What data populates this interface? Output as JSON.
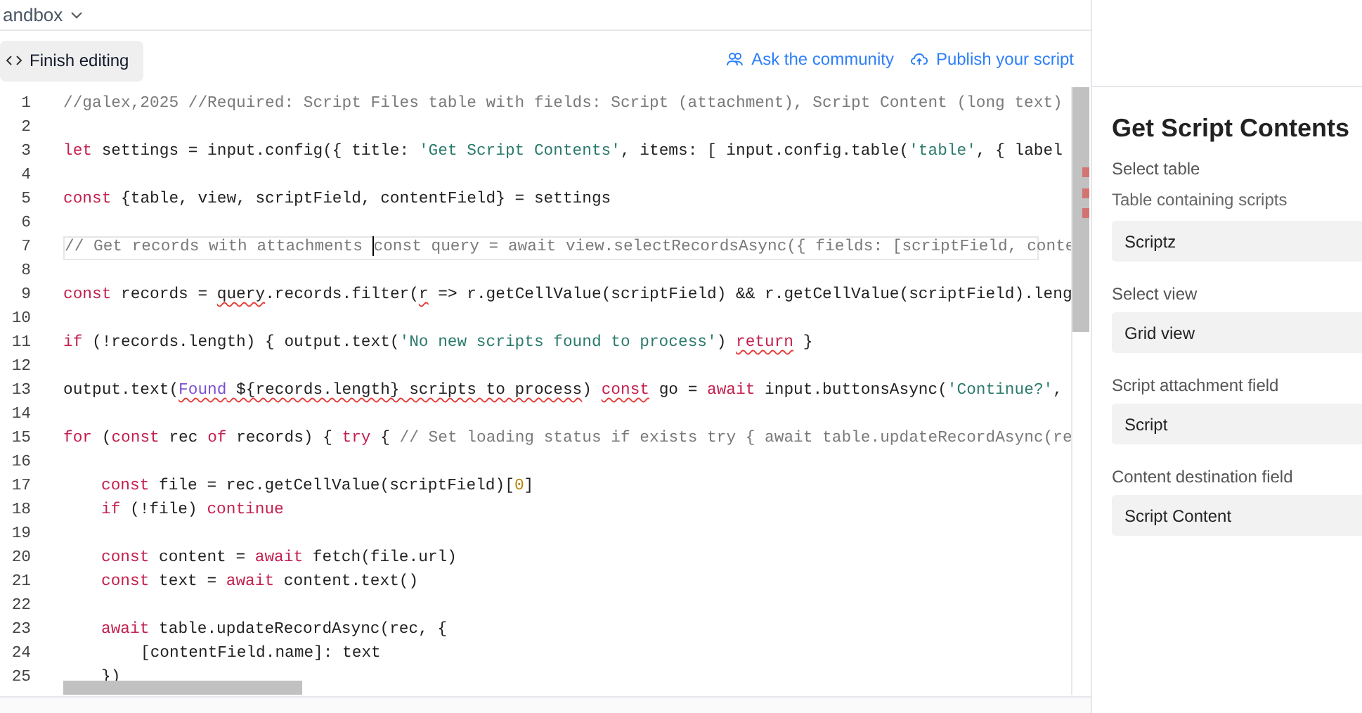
{
  "header": {
    "base_name": "andbox"
  },
  "toolbar": {
    "finish_button": "Finish editing",
    "links": [
      {
        "kind": "community",
        "label": "Ask the community"
      },
      {
        "kind": "publish",
        "label": "Publish your script"
      }
    ]
  },
  "editor": {
    "lines": [
      {
        "number": "1",
        "tokens": [
          {
            "t": "//galex,2025 //Required: Script Files table with fields: Script (attachment), Script Content (long text)",
            "kind": "comment"
          }
        ]
      },
      {
        "number": "2"
      },
      {
        "number": "3",
        "tokens": [
          {
            "t": "let",
            "kind": "keyword"
          },
          {
            "t": " settings = input.config({ title: ",
            "kind": "plain"
          },
          {
            "t": "'Get Script Contents'",
            "kind": "string"
          },
          {
            "t": ", items: [ input.config.table(",
            "kind": "plain"
          },
          {
            "t": "'table'",
            "kind": "string"
          },
          {
            "t": ", { label",
            "kind": "plain"
          }
        ]
      },
      {
        "number": "4"
      },
      {
        "number": "5",
        "tokens": [
          {
            "t": "const",
            "kind": "keyword"
          },
          {
            "t": " {table, view, scriptField, contentField} = settings",
            "kind": "plain"
          }
        ]
      },
      {
        "number": "6"
      },
      {
        "number": "7",
        "current": true,
        "tokens": [
          {
            "t": "// Get records with attachments ",
            "kind": "comment"
          },
          {
            "t": "const query = await view.selectRecordsAsync({ fields: [scriptField, conte",
            "kind": "comment",
            "cursor": true
          }
        ]
      },
      {
        "number": "8"
      },
      {
        "number": "9",
        "tokens": [
          {
            "t": "const",
            "kind": "keyword"
          },
          {
            "t": " records = ",
            "kind": "plain"
          },
          {
            "t": "query",
            "kind": "plain",
            "squiggle": true
          },
          {
            "t": ".records.filter(",
            "kind": "plain"
          },
          {
            "t": "r",
            "kind": "plain",
            "squiggle": true
          },
          {
            "t": " => r.getCellValue(scriptField) && r.getCellValue(scriptField).leng",
            "kind": "plain"
          }
        ]
      },
      {
        "number": "10"
      },
      {
        "number": "11",
        "tokens": [
          {
            "t": "if",
            "kind": "keyword"
          },
          {
            "t": " (!records.length) { output.text(",
            "kind": "plain"
          },
          {
            "t": "'No new scripts found to process'",
            "kind": "string"
          },
          {
            "t": ") ",
            "kind": "plain"
          },
          {
            "t": "return",
            "kind": "keyword",
            "squiggle": true
          },
          {
            "t": " }",
            "kind": "plain"
          }
        ]
      },
      {
        "number": "12"
      },
      {
        "number": "13",
        "tokens": [
          {
            "t": "output.text(",
            "kind": "plain"
          },
          {
            "t": "Found",
            "kind": "identifier",
            "squiggle": true
          },
          {
            "t": " ${records.length} scripts to process",
            "kind": "plain",
            "squiggle": true
          },
          {
            "t": ") ",
            "kind": "plain"
          },
          {
            "t": "const",
            "kind": "keyword",
            "squiggle": true
          },
          {
            "t": " go = ",
            "kind": "plain"
          },
          {
            "t": "await",
            "kind": "keyword"
          },
          {
            "t": " input.buttonsAsync(",
            "kind": "plain"
          },
          {
            "t": "'Continue?'",
            "kind": "string"
          },
          {
            "t": ",",
            "kind": "plain"
          }
        ]
      },
      {
        "number": "14"
      },
      {
        "number": "15",
        "tokens": [
          {
            "t": "for",
            "kind": "keyword"
          },
          {
            "t": " (",
            "kind": "plain"
          },
          {
            "t": "const",
            "kind": "keyword"
          },
          {
            "t": " rec ",
            "kind": "plain"
          },
          {
            "t": "of",
            "kind": "keyword"
          },
          {
            "t": " records) { ",
            "kind": "plain"
          },
          {
            "t": "try",
            "kind": "keyword"
          },
          {
            "t": " { ",
            "kind": "plain"
          },
          {
            "t": "// Set loading status if exists try { await table.updateRecordAsync(re",
            "kind": "comment"
          }
        ]
      },
      {
        "number": "16"
      },
      {
        "number": "17",
        "kind": "nested",
        "tokens": [
          {
            "t": "const",
            "kind": "keyword"
          },
          {
            "t": " file = rec.getCellValue(scriptField)[",
            "kind": "plain"
          },
          {
            "t": "0",
            "kind": "number"
          },
          {
            "t": "]",
            "kind": "plain"
          }
        ]
      },
      {
        "number": "18",
        "kind": "nested",
        "tokens": [
          {
            "t": "if",
            "kind": "keyword"
          },
          {
            "t": " (!file) ",
            "kind": "plain"
          },
          {
            "t": "continue",
            "kind": "keyword"
          }
        ]
      },
      {
        "number": "19"
      },
      {
        "number": "20",
        "kind": "nested",
        "tokens": [
          {
            "t": "const",
            "kind": "keyword"
          },
          {
            "t": " content = ",
            "kind": "plain"
          },
          {
            "t": "await",
            "kind": "keyword"
          },
          {
            "t": " fetch(file.url)",
            "kind": "plain"
          }
        ]
      },
      {
        "number": "21",
        "kind": "nested",
        "tokens": [
          {
            "t": "const",
            "kind": "keyword"
          },
          {
            "t": " text = ",
            "kind": "plain"
          },
          {
            "t": "await",
            "kind": "keyword"
          },
          {
            "t": " content.text()",
            "kind": "plain"
          }
        ]
      },
      {
        "number": "22"
      },
      {
        "number": "23",
        "kind": "nested",
        "tokens": [
          {
            "t": "await",
            "kind": "keyword"
          },
          {
            "t": " table.updateRecordAsync(rec, {",
            "kind": "plain"
          }
        ]
      },
      {
        "number": "24",
        "kind": "nested-twice",
        "tokens": [
          {
            "t": "[contentField.name]: text",
            "kind": "plain"
          }
        ]
      },
      {
        "number": "25",
        "kind": "nested",
        "tokens": [
          {
            "t": "})",
            "kind": "plain"
          }
        ]
      }
    ]
  },
  "panel": {
    "title": "Get Script Contents",
    "sections": [
      {
        "label": "Select table",
        "hint": "Table containing scripts",
        "value": "Scriptz"
      },
      {
        "label": "Select view",
        "value": "Grid view"
      },
      {
        "label": "Script attachment field",
        "value": "Script"
      },
      {
        "label": "Content destination field",
        "value": "Script Content"
      }
    ]
  }
}
